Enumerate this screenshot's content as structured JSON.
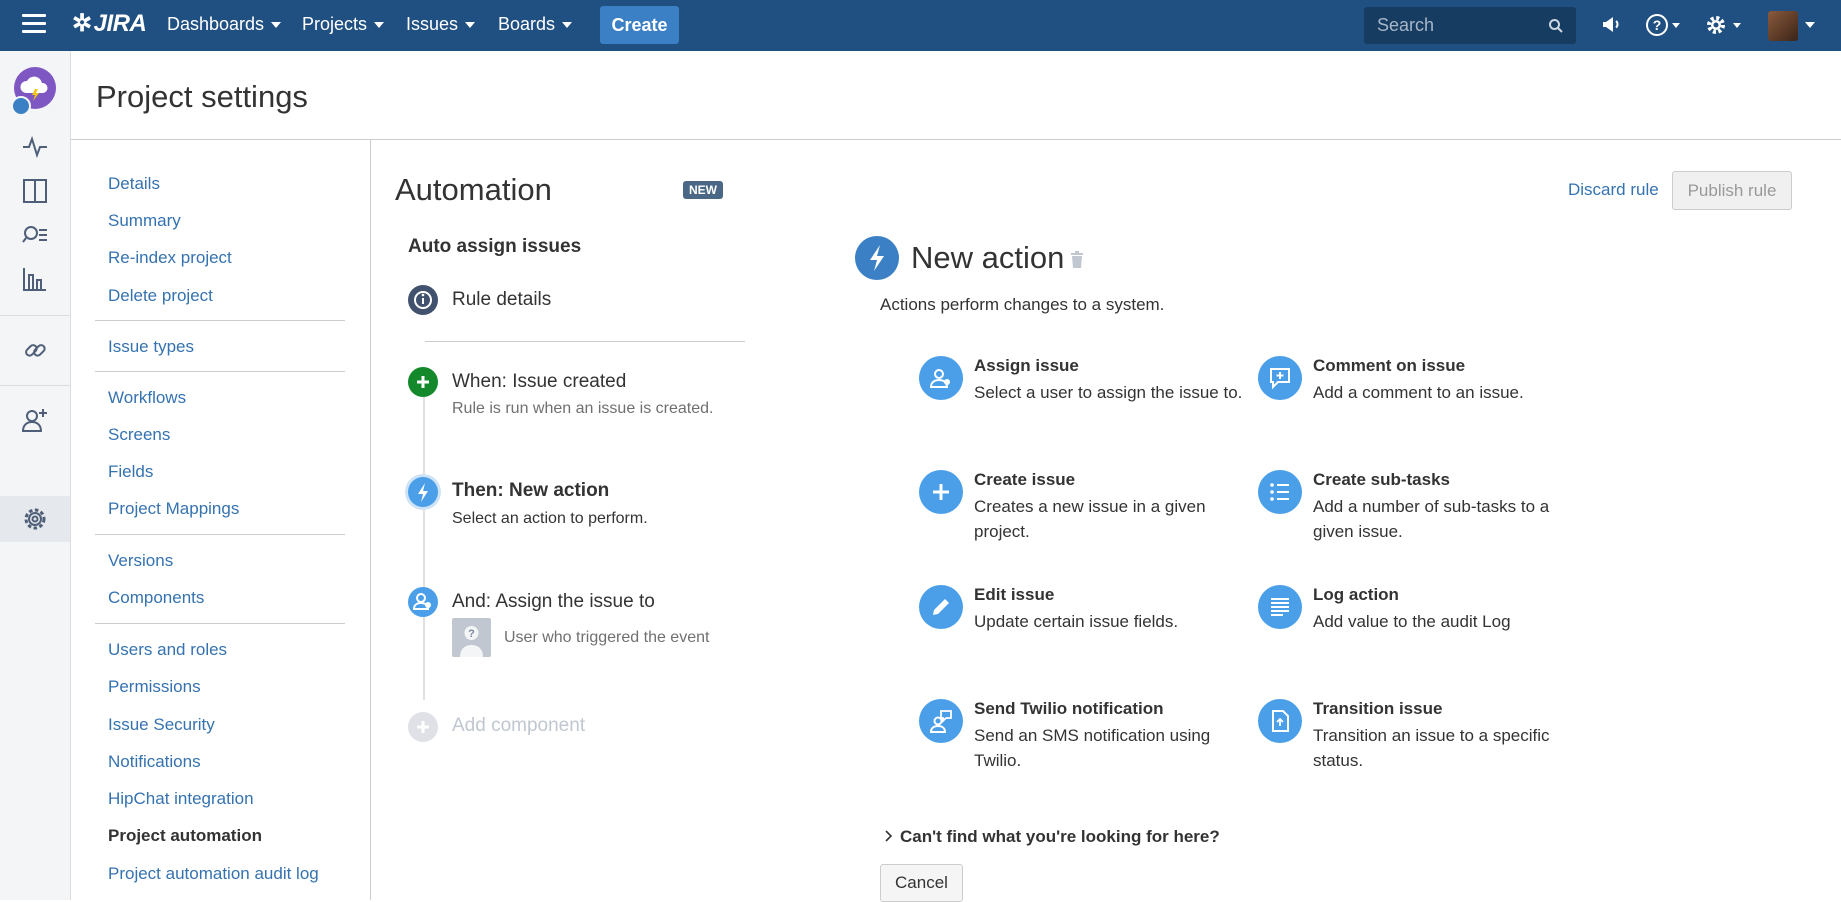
{
  "topnav": {
    "logo": "JIRA",
    "items": [
      {
        "label": "Dashboards"
      },
      {
        "label": "Projects"
      },
      {
        "label": "Issues"
      },
      {
        "label": "Boards"
      }
    ],
    "create_label": "Create",
    "search_placeholder": "Search"
  },
  "header": {
    "title": "Project settings"
  },
  "sidenav": {
    "items": [
      {
        "label": "Details"
      },
      {
        "label": "Summary"
      },
      {
        "label": "Re-index project"
      },
      {
        "label": "Delete project"
      },
      {
        "label": "Issue types"
      },
      {
        "label": "Workflows"
      },
      {
        "label": "Screens"
      },
      {
        "label": "Fields"
      },
      {
        "label": "Project Mappings"
      },
      {
        "label": "Versions"
      },
      {
        "label": "Components"
      },
      {
        "label": "Users and roles"
      },
      {
        "label": "Permissions"
      },
      {
        "label": "Issue Security"
      },
      {
        "label": "Notifications"
      },
      {
        "label": "HipChat integration"
      },
      {
        "label": "Project automation"
      },
      {
        "label": "Project automation audit log"
      }
    ]
  },
  "automation": {
    "title": "Automation",
    "badge": "NEW",
    "rule_name": "Auto assign issues",
    "rule_details": "Rule details",
    "when_title": "When: Issue created",
    "when_sub": "Rule is run when an issue is created.",
    "then_title": "Then: New action",
    "then_sub": "Select an action to perform.",
    "and_title": "And: Assign the issue to",
    "and_sub": "User who triggered the event",
    "add_component": "Add component"
  },
  "panel": {
    "discard_label": "Discard rule",
    "publish_label": "Publish rule",
    "title": "New action",
    "description": "Actions perform changes to a system.",
    "actions": [
      {
        "title": "Assign issue",
        "desc": "Select a user to assign the issue to."
      },
      {
        "title": "Comment on issue",
        "desc": "Add a comment to an issue."
      },
      {
        "title": "Create issue",
        "desc": "Creates a new issue in a given project."
      },
      {
        "title": "Create sub-tasks",
        "desc": "Add a number of sub-tasks to a given issue."
      },
      {
        "title": "Edit issue",
        "desc": "Update certain issue fields."
      },
      {
        "title": "Log action",
        "desc": "Add value to the audit Log"
      },
      {
        "title": "Send Twilio notification",
        "desc": "Send an SMS notification using Twilio."
      },
      {
        "title": "Transition issue",
        "desc": "Transition an issue to a specific status."
      }
    ],
    "cant_find": "Can't find what you're looking for here?",
    "cancel_label": "Cancel"
  }
}
